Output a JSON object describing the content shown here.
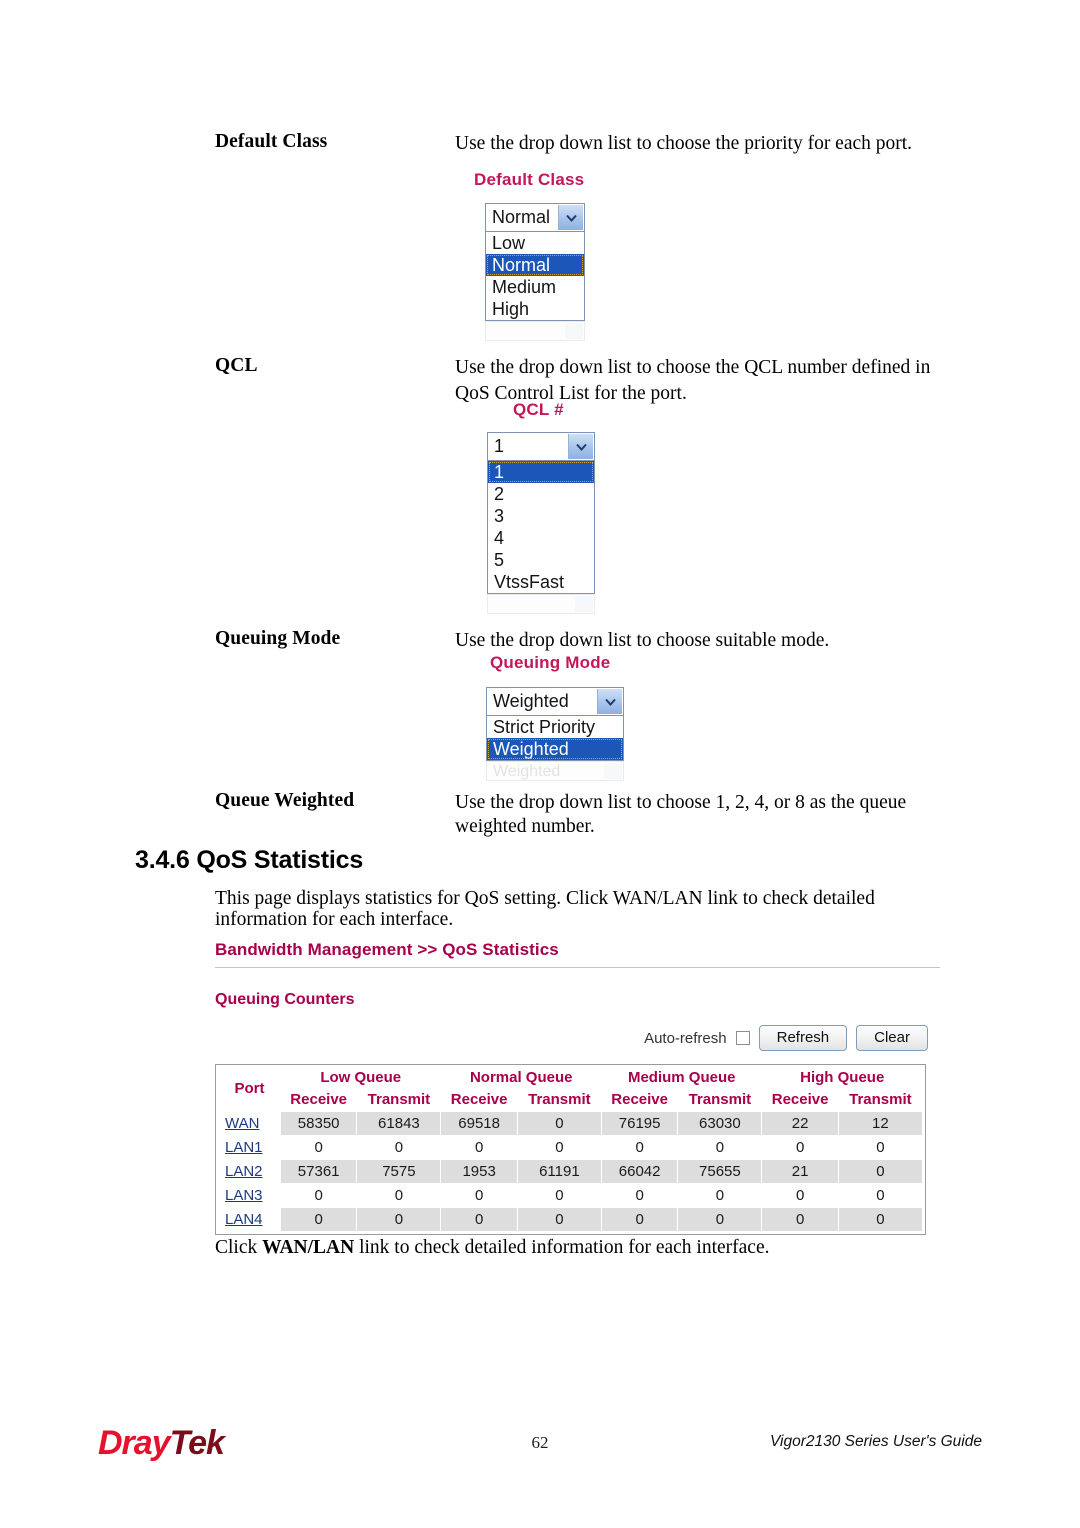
{
  "definitions": [
    {
      "term": "Default Class",
      "description": "Use the drop down list to choose the priority for each port."
    },
    {
      "term": "QCL",
      "description_line1": "Use the drop down list to choose the QCL number defined in",
      "description_line2": "QoS Control List for the port."
    },
    {
      "term": "Queuing Mode",
      "description": "Use the drop down list to choose suitable mode."
    },
    {
      "term": "Queue Weighted",
      "description_line1": "Use the drop down list to choose 1, 2, 4, or 8 as the queue",
      "description_line2": "weighted number."
    }
  ],
  "figures": {
    "default_class": {
      "label": "Default Class",
      "selected": "Normal",
      "options": [
        "Low",
        "Normal",
        "Medium",
        "High"
      ]
    },
    "qcl": {
      "label": "QCL #",
      "selected": "1",
      "options": [
        "1",
        "2",
        "3",
        "4",
        "5",
        "VtssFast"
      ]
    },
    "queuing_mode": {
      "label": "Queuing Mode",
      "selected": "Weighted",
      "options": [
        "Strict Priority",
        "Weighted"
      ],
      "ghost_text": "Weighted"
    }
  },
  "section": {
    "number_and_title": "3.4.6 QoS Statistics",
    "intro_line1": "This page displays statistics for QoS setting. Click WAN/LAN link to check detailed",
    "intro_line2": "information for each interface.",
    "outro_prefix": "Click ",
    "outro_bold": "WAN/LAN",
    "outro_suffix": " link to check detailed information for each interface."
  },
  "panel": {
    "breadcrumb": "Bandwidth Management >> QoS Statistics",
    "subtitle": "Queuing Counters",
    "toolbar": {
      "auto_refresh_label": "Auto-refresh",
      "auto_refresh_checked": false,
      "refresh_label": "Refresh",
      "clear_label": "Clear"
    },
    "table": {
      "port_header": "Port",
      "queue_groups": [
        "Low Queue",
        "Normal Queue",
        "Medium Queue",
        "High Queue"
      ],
      "sub_headers": [
        "Receive",
        "Transmit"
      ],
      "rows": [
        {
          "port": "WAN",
          "values": [
            "58350",
            "61843",
            "69518",
            "0",
            "76195",
            "63030",
            "22",
            "12"
          ]
        },
        {
          "port": "LAN1",
          "values": [
            "0",
            "0",
            "0",
            "0",
            "0",
            "0",
            "0",
            "0"
          ]
        },
        {
          "port": "LAN2",
          "values": [
            "57361",
            "7575",
            "1953",
            "61191",
            "66042",
            "75655",
            "21",
            "0"
          ]
        },
        {
          "port": "LAN3",
          "values": [
            "0",
            "0",
            "0",
            "0",
            "0",
            "0",
            "0",
            "0"
          ]
        },
        {
          "port": "LAN4",
          "values": [
            "0",
            "0",
            "0",
            "0",
            "0",
            "0",
            "0",
            "0"
          ]
        }
      ]
    }
  },
  "footer": {
    "logo_part1": "Dray",
    "logo_part2": "Tek",
    "page_number": "62",
    "guide_title": "Vigor2130 Series User's Guide"
  },
  "colors": {
    "ui_label_pink": "#c2185b",
    "panel_crimson": "#a8004a",
    "select_highlight": "#1b56b8",
    "logo_red": "#e8112d"
  }
}
